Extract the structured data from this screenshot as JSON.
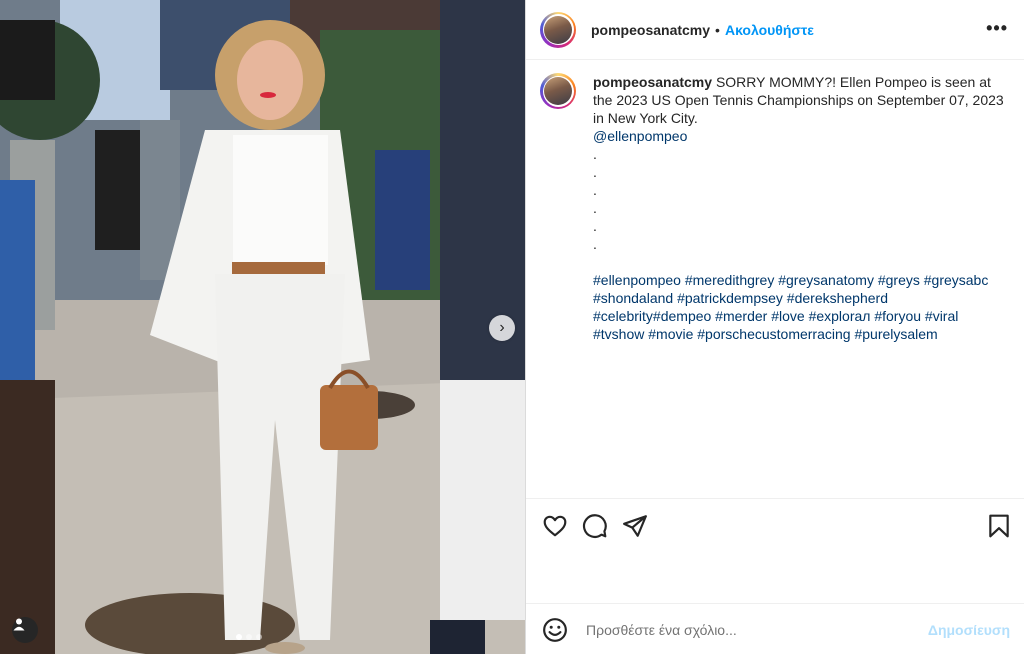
{
  "post": {
    "username": "pompeosanatcmy",
    "follow_label": "Ακολουθήστε",
    "separator": "•",
    "more_label": "•••",
    "caption_text": "SORRY MOMMY?! Ellen Pompeo is seen at the 2023 US Open Tennis Championships on September 07, 2023 in New York City.",
    "mention": "@ellenpompeo",
    "dots": [
      ".",
      ".",
      ".",
      ".",
      ".",
      "."
    ],
    "hashtags": "#ellenpompeo #meredithgrey #greysanatomy #greys #greysabc #shondaland #patrickdempsey #derekshepherd #celebrity#dempeo #merder #love #explorал #foryou #viral #tvshow #movie #porschecustomerracing #purelysalem"
  },
  "comment": {
    "placeholder": "Προσθέστε ένα σχόλιο...",
    "post_label": "Δημοσίευση"
  },
  "carousel": {
    "slides": 3,
    "active_index": 0
  },
  "colors": {
    "link_blue": "#0095f6",
    "hashtag": "#00376b",
    "post_disabled": "#b2dffc"
  },
  "icons": [
    "heart-icon",
    "comment-icon",
    "share-icon",
    "bookmark-icon",
    "emoji-icon",
    "chevron-right-icon",
    "user-tag-icon",
    "more-icon"
  ]
}
